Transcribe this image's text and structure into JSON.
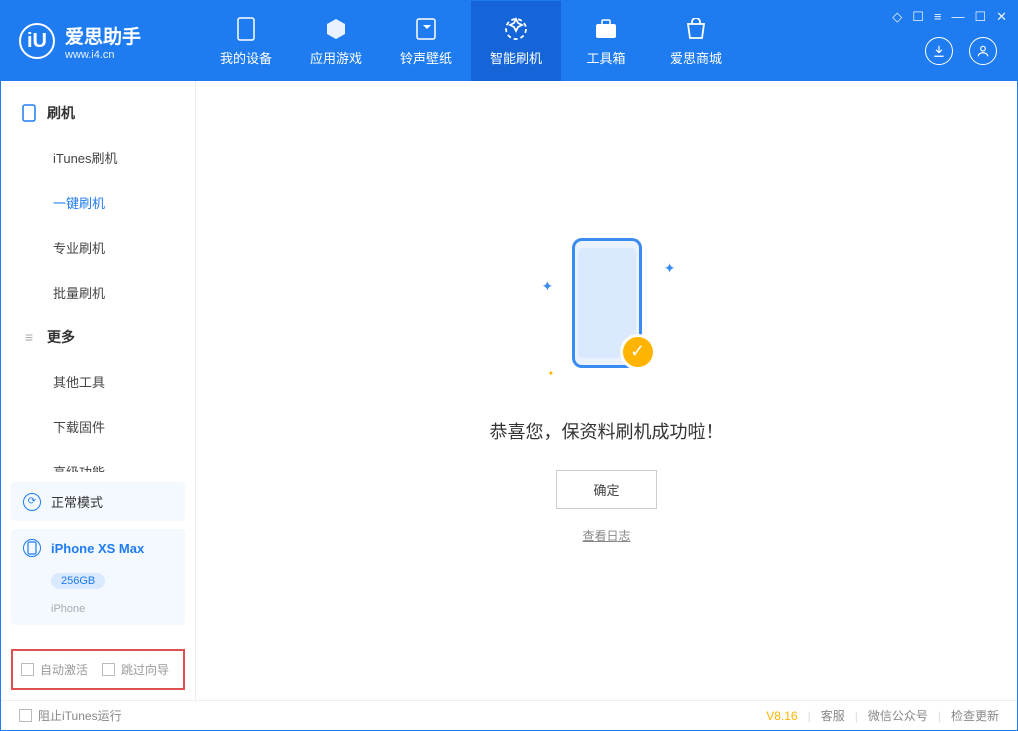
{
  "app": {
    "name": "爱思助手",
    "url": "www.i4.cn",
    "logo_letter": "iU"
  },
  "header": {
    "tabs": [
      "我的设备",
      "应用游戏",
      "铃声壁纸",
      "智能刷机",
      "工具箱",
      "爱思商城"
    ],
    "active_tab": 3
  },
  "sidebar": {
    "groups": [
      {
        "title": "刷机",
        "items": [
          "iTunes刷机",
          "一键刷机",
          "专业刷机",
          "批量刷机"
        ],
        "active_item": 1
      },
      {
        "title": "更多",
        "items": [
          "其他工具",
          "下载固件",
          "高级功能"
        ],
        "active_item": -1
      }
    ],
    "mode": "正常模式",
    "device": {
      "name": "iPhone XS Max",
      "capacity": "256GB",
      "type": "iPhone"
    },
    "options": {
      "auto_activate": "自动激活",
      "skip_guide": "跳过向导"
    }
  },
  "main": {
    "success_message": "恭喜您，保资料刷机成功啦！",
    "ok_button": "确定",
    "view_log": "查看日志"
  },
  "footer": {
    "block_itunes": "阻止iTunes运行",
    "version": "V8.16",
    "links": [
      "客服",
      "微信公众号",
      "检查更新"
    ]
  }
}
